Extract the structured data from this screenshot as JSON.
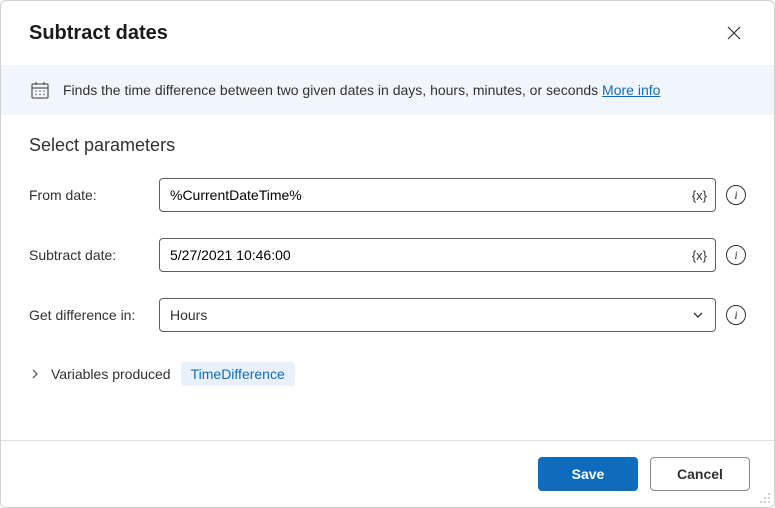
{
  "dialog": {
    "title": "Subtract dates"
  },
  "banner": {
    "text": "Finds the time difference between two given dates in days, hours, minutes, or seconds ",
    "link": "More info"
  },
  "section": {
    "title": "Select parameters"
  },
  "fields": {
    "from_label": "From date:",
    "from_value": "%CurrentDateTime%",
    "subtract_label": "Subtract date:",
    "subtract_value": "5/27/2021 10:46:00",
    "diff_label": "Get difference in:",
    "diff_value": "Hours",
    "var_btn": "{x}"
  },
  "variables": {
    "label": "Variables produced",
    "chip": "TimeDifference"
  },
  "footer": {
    "save": "Save",
    "cancel": "Cancel"
  }
}
